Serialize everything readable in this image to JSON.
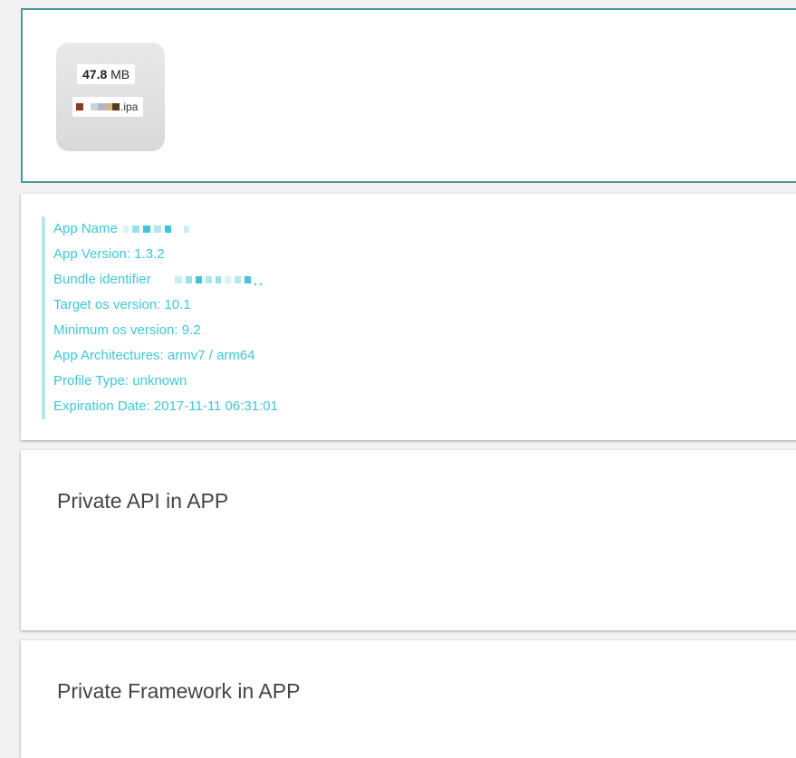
{
  "upload": {
    "size_value": "47.8",
    "size_unit": "MB",
    "file_ext": ".ipa"
  },
  "info": {
    "app_name_label": "App Name",
    "app_version": "App Version: 1.3.2",
    "bundle_id_label": "Bundle identifier",
    "target_os": "Target os version: 10.1",
    "minimum_os": "Minimum os version: 9.2",
    "architectures": "App Architectures: armv7 / arm64",
    "profile_type": "Profile Type: unknown",
    "expiration": "Expiration Date: 2017-11-11 06:31:01"
  },
  "sections": {
    "private_api_title": "Private API in APP",
    "private_framework_title": "Private Framework in APP"
  },
  "colors": {
    "accent_text": "#3fc7d6",
    "quote_border": "#b4e8ef",
    "upload_border": "#4a9a96"
  }
}
